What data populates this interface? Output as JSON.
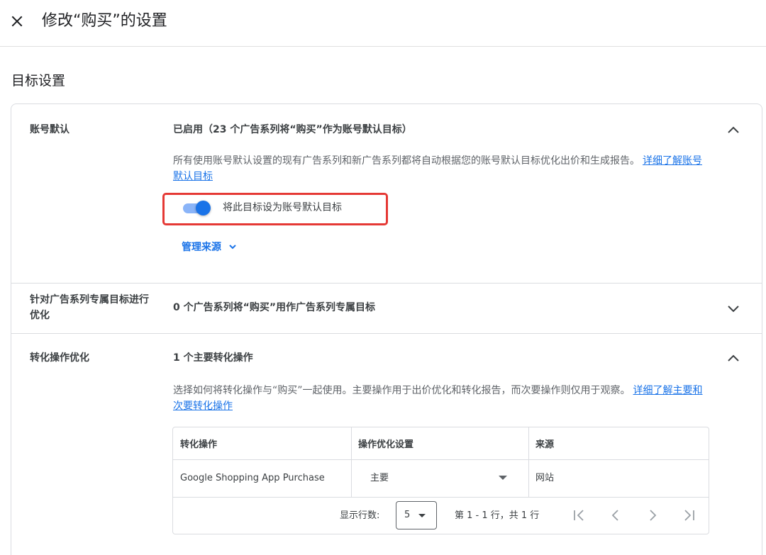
{
  "header": {
    "title": "修改“购买”的设置"
  },
  "section": {
    "title": "目标设置"
  },
  "account_default": {
    "label": "账号默认",
    "summary": "已启用（23 个广告系列将“购买”作为账号默认目标）",
    "description": "所有使用账号默认设置的现有广告系列和新广告系列都将自动根据您的账号默认目标优化出价和生成报告。",
    "link": "详细了解账号默认目标",
    "toggle_label": "将此目标设为账号默认目标",
    "toggle_on": true,
    "manage_source": "管理来源"
  },
  "campaign_specific": {
    "label_line1": "针对广告系列专属目标进行",
    "label_line2": "优化",
    "summary": "0 个广告系列将“购买”用作广告系列专属目标"
  },
  "conversion_optimization": {
    "label": "转化操作优化",
    "summary": "1 个主要转化操作",
    "description": "选择如何将转化操作与“购买”一起使用。主要操作用于出价优化和转化报告，而次要操作则仅用于观察。",
    "link": "详细了解主要和次要转化操作",
    "table": {
      "headers": [
        "转化操作",
        "操作优化设置",
        "来源"
      ],
      "rows": [
        {
          "action": "Google Shopping App Purchase",
          "setting": "主要",
          "source": "网站"
        }
      ]
    },
    "pagination": {
      "rows_label": "显示行数:",
      "rows_value": "5",
      "page_info": "第 1 - 1 行，共 1 行"
    }
  },
  "colors": {
    "accent": "#1a73e8",
    "highlight": "#e53935"
  }
}
